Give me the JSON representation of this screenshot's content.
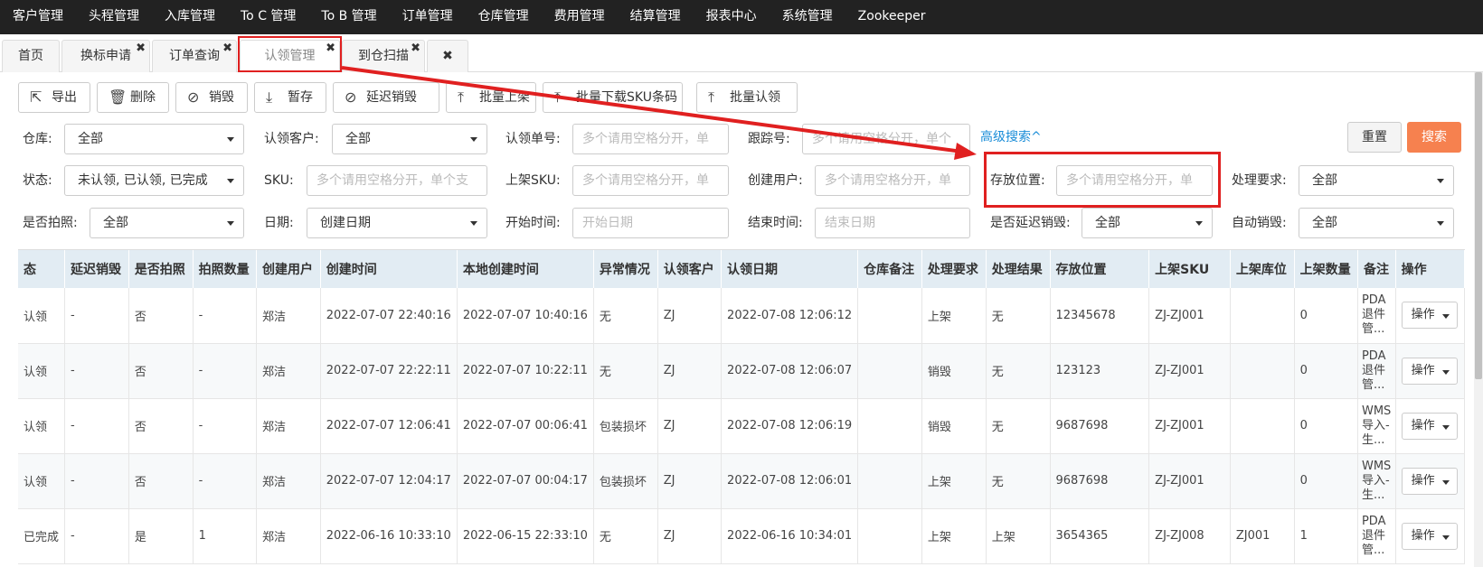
{
  "topnav": [
    "客户管理",
    "头程管理",
    "入库管理",
    "To C 管理",
    "To B 管理",
    "订单管理",
    "仓库管理",
    "费用管理",
    "结算管理",
    "报表中心",
    "系统管理",
    "Zookeeper"
  ],
  "tabs": {
    "home": "首页",
    "relabel": "换标申请",
    "order_query": "订单查询",
    "claim": "认领管理",
    "arrival_scan": "到仓扫描",
    "close_glyph": "✖"
  },
  "toolbar": {
    "export": "导出",
    "delete": "删除",
    "destroy": "销毁",
    "hold": "暂存",
    "delay_destroy": "延迟销毁",
    "batch_shelve": "批量上架",
    "batch_download_sku": "批量下载SKU条码",
    "batch_claim": "批量认领"
  },
  "filters": {
    "warehouse_label": "仓库:",
    "warehouse_value": "全部",
    "claim_customer_label": "认领客户:",
    "claim_customer_value": "全部",
    "claim_no_label": "认领单号:",
    "claim_no_placeholder": "多个请用空格分开，单",
    "tracking_label": "跟踪号:",
    "tracking_placeholder": "多个请用空格分开，单个",
    "advanced_search": "高级搜索^",
    "status_label": "状态:",
    "status_value": "未认领, 已认领, 已完成",
    "sku_label": "SKU:",
    "sku_placeholder": "多个请用空格分开，单个支",
    "shelf_sku_label": "上架SKU:",
    "shelf_sku_placeholder": "多个请用空格分开，单",
    "creator_label": "创建用户:",
    "creator_placeholder": "多个请用空格分开，单",
    "storage_label": "存放位置:",
    "storage_placeholder": "多个请用空格分开，单",
    "process_req_label": "处理要求:",
    "process_req_value": "全部",
    "photo_label": "是否拍照:",
    "photo_value": "全部",
    "date_label": "日期:",
    "date_value": "创建日期",
    "start_label": "开始时间:",
    "start_placeholder": "开始日期",
    "end_label": "结束时间:",
    "end_placeholder": "结束日期",
    "delay_destroy_label": "是否延迟销毁:",
    "delay_destroy_value": "全部",
    "auto_destroy_label": "自动销毁:",
    "auto_destroy_value": "全部",
    "reset": "重置",
    "search": "搜索"
  },
  "table": {
    "headers": [
      "态",
      "延迟销毁",
      "是否拍照",
      "拍照数量",
      "创建用户",
      "创建时间",
      "本地创建时间",
      "异常情况",
      "认领客户",
      "认领日期",
      "仓库备注",
      "处理要求",
      "处理结果",
      "存放位置",
      "上架SKU",
      "上架库位",
      "上架数量",
      "备注",
      "操作"
    ],
    "rows": [
      [
        "认领",
        "-",
        "否",
        "-",
        "郑洁",
        "2022-07-07 22:40:16",
        "2022-07-07 10:40:16",
        "无",
        "ZJ",
        "2022-07-08 12:06:12",
        "",
        "上架",
        "无",
        "12345678",
        "ZJ-ZJ001",
        "",
        "0",
        "PDA退件管...",
        "操作"
      ],
      [
        "认领",
        "-",
        "否",
        "-",
        "郑洁",
        "2022-07-07 22:22:11",
        "2022-07-07 10:22:11",
        "无",
        "ZJ",
        "2022-07-08 12:06:07",
        "",
        "销毁",
        "无",
        "123123",
        "ZJ-ZJ001",
        "",
        "0",
        "PDA退件管...",
        "操作"
      ],
      [
        "认领",
        "-",
        "否",
        "-",
        "郑洁",
        "2022-07-07 12:06:41",
        "2022-07-07 00:06:41",
        "包装损坏",
        "ZJ",
        "2022-07-08 12:06:19",
        "",
        "销毁",
        "无",
        "9687698",
        "ZJ-ZJ001",
        "",
        "0",
        "WMS导入-生...",
        "操作"
      ],
      [
        "认领",
        "-",
        "否",
        "-",
        "郑洁",
        "2022-07-07 12:04:17",
        "2022-07-07 00:04:17",
        "包装损坏",
        "ZJ",
        "2022-07-08 12:06:01",
        "",
        "上架",
        "无",
        "9687698",
        "ZJ-ZJ001",
        "",
        "0",
        "WMS导入-生...",
        "操作"
      ],
      [
        "已完成",
        "-",
        "是",
        "1",
        "郑洁",
        "2022-06-16 10:33:10",
        "2022-06-15 22:33:10",
        "无",
        "ZJ",
        "2022-06-16 10:34:01",
        "",
        "上架",
        "上架",
        "3654365",
        "ZJ-ZJ008",
        "ZJ001",
        "1",
        "PDA退件管...",
        "操作"
      ]
    ]
  },
  "colors": {
    "topnav_bg": "#222222",
    "accent_orange": "#f6814f",
    "link_blue": "#1a8dd8",
    "highlight_red": "#e02020",
    "table_header_bg": "#e2ecf3"
  }
}
